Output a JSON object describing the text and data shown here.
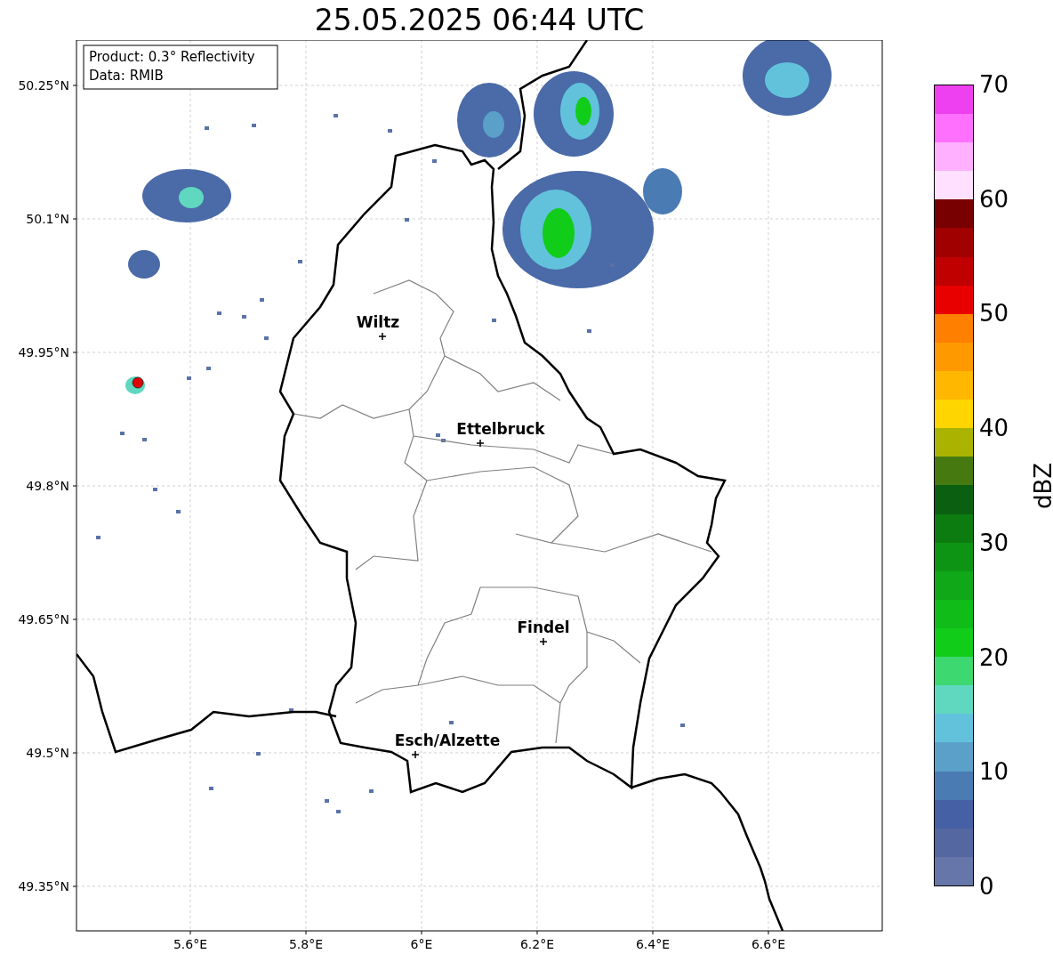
{
  "title": "25.05.2025 06:44 UTC",
  "legend": [
    "Product: 0.3° Reflectivity",
    "Data: RMIB"
  ],
  "map": {
    "lat_labels": [
      "50.25°N",
      "50.1°N",
      "49.95°N",
      "49.8°N",
      "49.65°N",
      "49.5°N",
      "49.35°N"
    ],
    "lon_labels": [
      "5.6°E",
      "5.8°E",
      "6°E",
      "6.2°E",
      "6.4°E",
      "6.6°E"
    ],
    "cities": [
      {
        "name": "Wiltz"
      },
      {
        "name": "Ettelbruck"
      },
      {
        "name": "Findel"
      },
      {
        "name": "Esch/Alzette"
      }
    ]
  },
  "colorbar": {
    "label": "dBZ",
    "ticks": [
      "70",
      "60",
      "50",
      "40",
      "30",
      "20",
      "10",
      "0"
    ],
    "bins": [
      {
        "color": "#6676a8"
      },
      {
        "color": "#5567a0"
      },
      {
        "color": "#4560a4"
      },
      {
        "color": "#4a7bb2"
      },
      {
        "color": "#5aa0c8"
      },
      {
        "color": "#62c2dc"
      },
      {
        "color": "#60d8c0"
      },
      {
        "color": "#3ed870"
      },
      {
        "color": "#12cc1a"
      },
      {
        "color": "#10bc18"
      },
      {
        "color": "#10a818"
      },
      {
        "color": "#0e9414"
      },
      {
        "color": "#0c7c10"
      },
      {
        "color": "#0a6010"
      },
      {
        "color": "#467a10"
      },
      {
        "color": "#aab400"
      },
      {
        "color": "#ffd500"
      },
      {
        "color": "#ffb700"
      },
      {
        "color": "#ff9900"
      },
      {
        "color": "#ff7f00"
      },
      {
        "color": "#e80000"
      },
      {
        "color": "#c00000"
      },
      {
        "color": "#a00000"
      },
      {
        "color": "#780000"
      },
      {
        "color": "#ffe0ff"
      },
      {
        "color": "#ffb0ff"
      },
      {
        "color": "#ff70ff"
      },
      {
        "color": "#ee40ee"
      }
    ]
  }
}
